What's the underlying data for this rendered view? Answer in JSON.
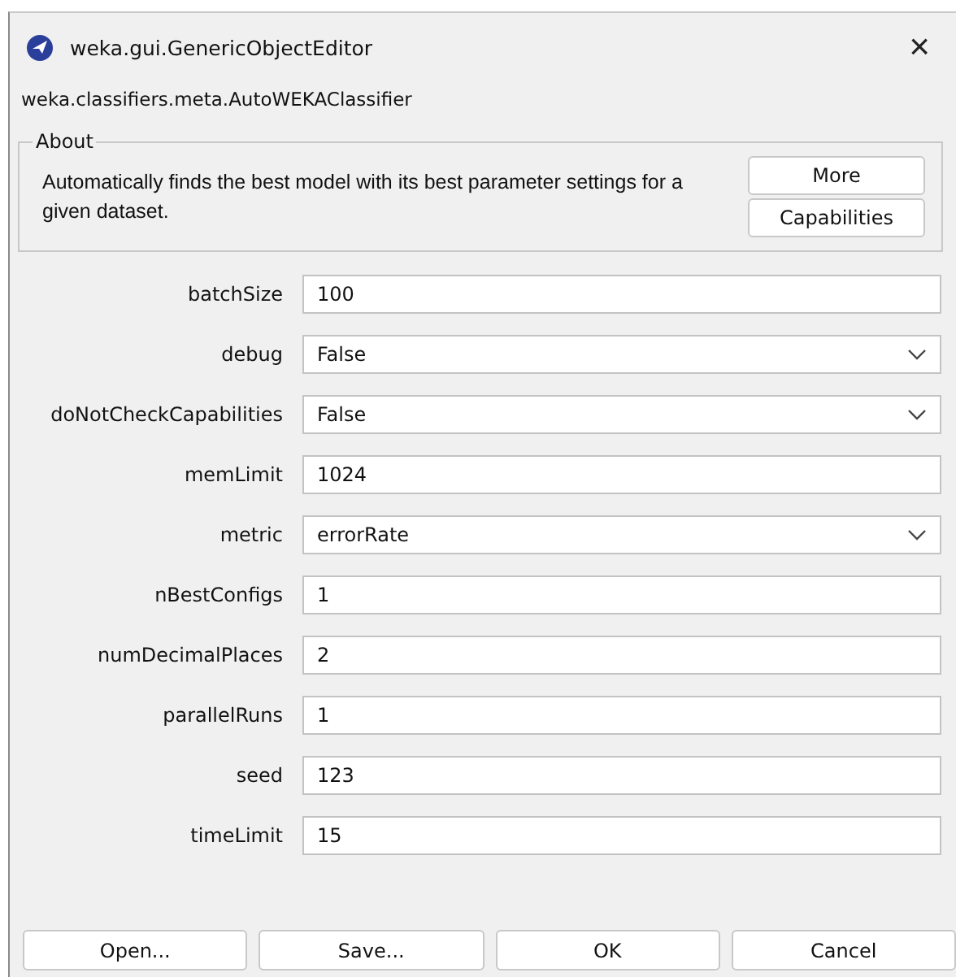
{
  "window": {
    "title": "weka.gui.GenericObjectEditor",
    "close": "×"
  },
  "class_name": "weka.classifiers.meta.AutoWEKAClassifier",
  "about": {
    "title": "About",
    "text": "Automatically finds the best model with its best parameter settings for a given dataset.",
    "buttons": [
      "More",
      "Capabilities"
    ]
  },
  "properties": [
    {
      "name": "batchSize",
      "kind": "text",
      "value": "100"
    },
    {
      "name": "debug",
      "kind": "dropdown",
      "value": "False"
    },
    {
      "name": "doNotCheckCapabilities",
      "kind": "dropdown",
      "value": "False"
    },
    {
      "name": "memLimit",
      "kind": "text",
      "value": "1024"
    },
    {
      "name": "metric",
      "kind": "dropdown",
      "value": "errorRate"
    },
    {
      "name": "nBestConfigs",
      "kind": "text",
      "value": "1"
    },
    {
      "name": "numDecimalPlaces",
      "kind": "text",
      "value": "2"
    },
    {
      "name": "parallelRuns",
      "kind": "text",
      "value": "1"
    },
    {
      "name": "seed",
      "kind": "text",
      "value": "123"
    },
    {
      "name": "timeLimit",
      "kind": "text",
      "value": "15"
    }
  ],
  "buttons": [
    "Open...",
    "Save...",
    "OK",
    "Cancel"
  ]
}
